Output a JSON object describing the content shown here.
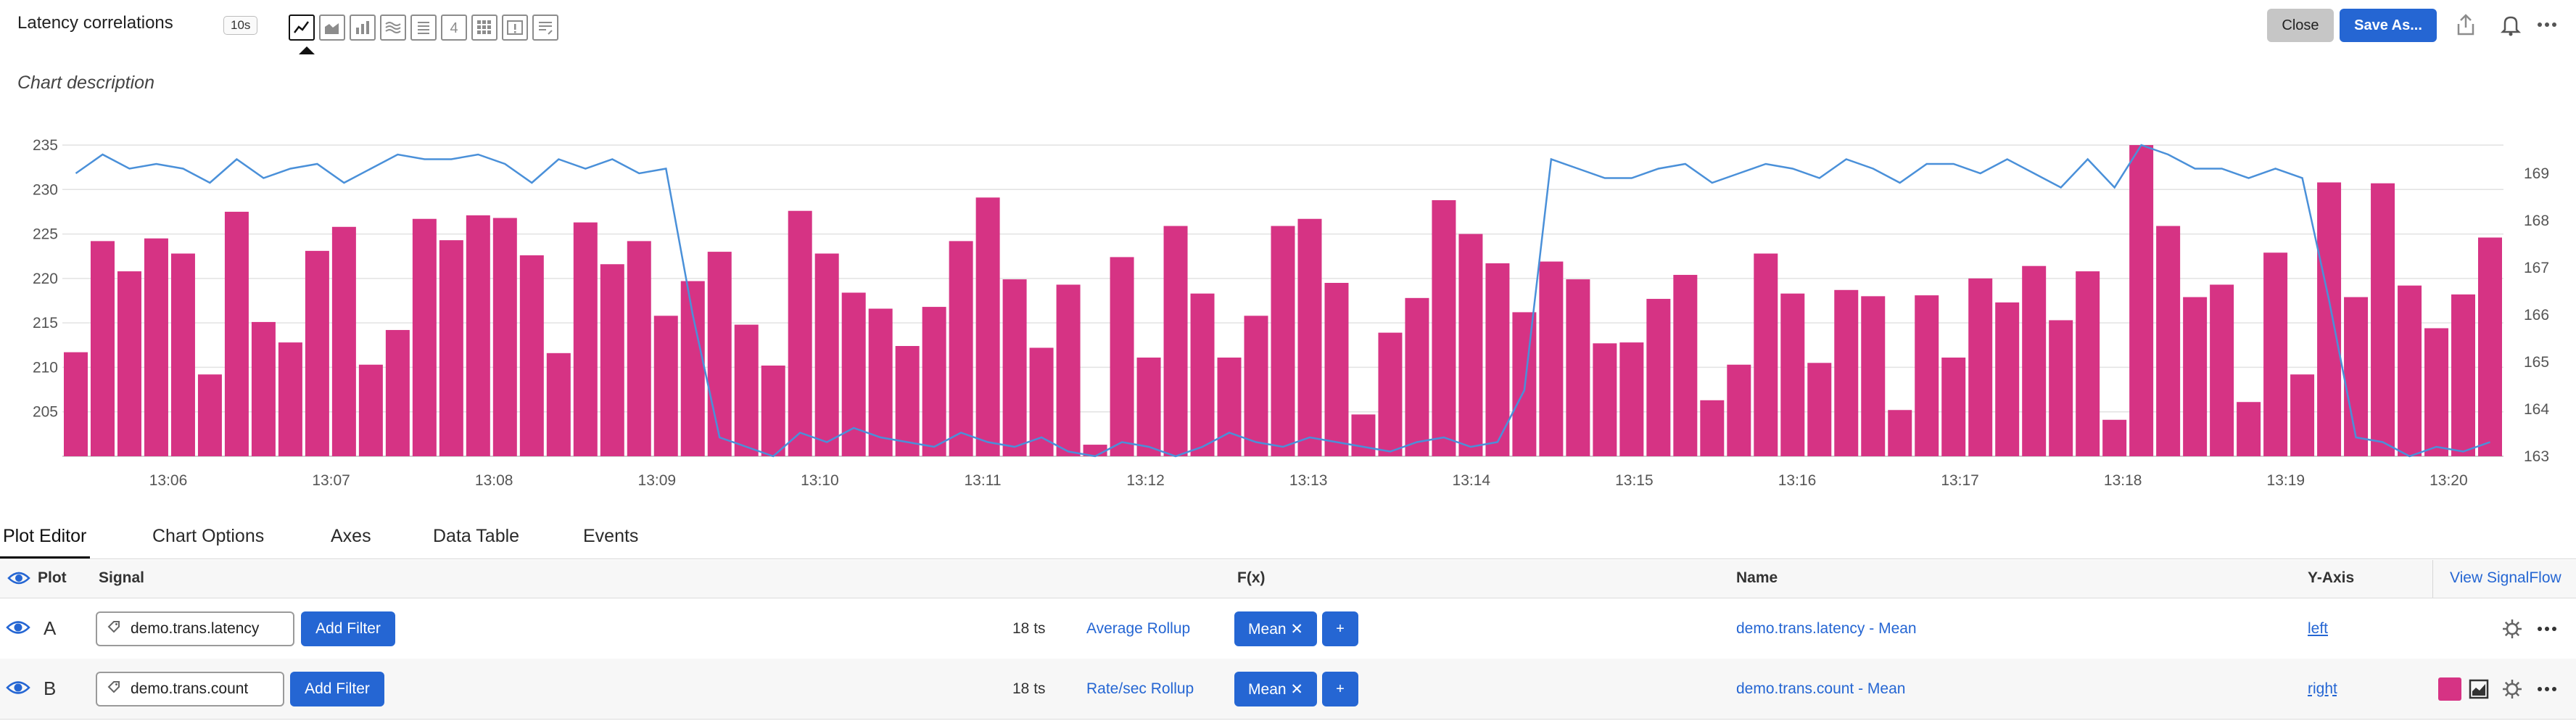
{
  "header": {
    "title": "Latency correlations",
    "resolution": "10s",
    "visualization_types": [
      "line-chart",
      "area-chart",
      "column-chart",
      "histogram",
      "list",
      "single-value",
      "heatmap",
      "event-feed",
      "text"
    ],
    "active_type": "line-chart",
    "close_label": "Close",
    "save_label": "Save As...",
    "accent_color": "#2566d3"
  },
  "description": "Chart description",
  "chart_data": {
    "type": "bar",
    "x_tick_labels": [
      "13:06",
      "13:07",
      "13:08",
      "13:09",
      "13:10",
      "13:11",
      "13:12",
      "13:13",
      "13:14",
      "13:15",
      "13:16",
      "13:17",
      "13:18",
      "13:19",
      "13:20"
    ],
    "y_left": {
      "ticks": [
        205,
        210,
        215,
        220,
        225,
        230,
        235
      ],
      "range": [
        200,
        235
      ]
    },
    "y_right": {
      "ticks": [
        163,
        164,
        165,
        166,
        167,
        168,
        169
      ],
      "range": [
        163,
        169.6
      ]
    },
    "grid": true,
    "series": [
      {
        "name": "demo.trans.latency - Mean",
        "axis": "left",
        "render": "column",
        "color": "#d63384",
        "values": [
          211.7,
          224.2,
          220.8,
          224.5,
          222.8,
          209.2,
          227.5,
          215.1,
          212.8,
          223.1,
          225.8,
          210.3,
          214.2,
          226.7,
          224.3,
          227.1,
          226.8,
          222.6,
          211.6,
          226.3,
          221.6,
          224.2,
          215.8,
          219.7,
          223.0,
          214.8,
          210.2,
          227.6,
          222.8,
          218.4,
          216.6,
          212.4,
          216.8,
          224.2,
          229.1,
          219.9,
          212.2,
          219.3,
          201.3,
          222.4,
          211.1,
          225.9,
          218.3,
          211.1,
          215.8,
          225.9,
          226.7,
          219.5,
          204.7,
          213.9,
          217.8,
          228.8,
          225.0,
          221.7,
          216.2,
          221.9,
          219.9,
          212.7,
          212.8,
          217.7,
          220.4,
          206.3,
          210.3,
          222.8,
          218.3,
          210.5,
          218.7,
          218.0,
          205.2,
          218.1,
          211.1,
          220.0,
          217.3,
          221.4,
          215.3,
          220.8,
          204.1,
          235.0,
          225.9,
          217.9,
          219.3,
          206.1,
          222.9,
          209.2,
          230.8,
          217.9,
          230.7,
          219.2,
          214.4,
          218.2,
          224.6
        ]
      },
      {
        "name": "demo.trans.count - Mean",
        "axis": "right",
        "render": "line",
        "color": "#4a90d9",
        "values": [
          169.0,
          169.4,
          169.1,
          169.2,
          169.1,
          168.8,
          169.3,
          168.9,
          169.1,
          169.2,
          168.8,
          169.1,
          169.4,
          169.3,
          169.3,
          169.4,
          169.2,
          168.8,
          169.3,
          169.1,
          169.3,
          169.0,
          169.1,
          166.0,
          163.4,
          163.2,
          163.0,
          163.5,
          163.3,
          163.6,
          163.4,
          163.3,
          163.2,
          163.5,
          163.3,
          163.2,
          163.4,
          163.1,
          163.0,
          163.3,
          163.2,
          163.0,
          163.2,
          163.5,
          163.3,
          163.2,
          163.4,
          163.3,
          163.2,
          163.1,
          163.3,
          163.4,
          163.2,
          163.3,
          164.4,
          169.3,
          169.1,
          168.9,
          168.9,
          169.1,
          169.2,
          168.8,
          169.0,
          169.2,
          169.1,
          168.9,
          169.3,
          169.1,
          168.8,
          169.2,
          169.2,
          169.0,
          169.3,
          169.0,
          168.7,
          169.3,
          168.7,
          169.6,
          169.4,
          169.1,
          169.1,
          168.9,
          169.1,
          168.9,
          166.3,
          163.4,
          163.3,
          163.0,
          163.2,
          163.1,
          163.3
        ]
      }
    ]
  },
  "tabs": [
    "Plot Editor",
    "Chart Options",
    "Axes",
    "Data Table",
    "Events"
  ],
  "active_tab": "Plot Editor",
  "table": {
    "headers": {
      "plot": "Plot",
      "signal": "Signal",
      "fx": "F(x)",
      "name": "Name",
      "y_axis": "Y-Axis",
      "view_signalflow": "View SignalFlow"
    },
    "rows": [
      {
        "letter": "A",
        "signal": "demo.trans.latency",
        "add_filter": "Add Filter",
        "ts_count": "18 ts",
        "rollup": "Average Rollup",
        "fx": "Mean ✕",
        "fx_add": "+",
        "name": "demo.trans.latency - Mean",
        "y_axis": "left",
        "icons": [
          "gear-icon",
          "more-icon"
        ]
      },
      {
        "letter": "B",
        "signal": "demo.trans.count",
        "add_filter": "Add Filter",
        "ts_count": "18 ts",
        "rollup": "Rate/sec Rollup",
        "fx": "Mean ✕",
        "fx_add": "+",
        "name": "demo.trans.count - Mean",
        "y_axis": "right",
        "color": "#d63384",
        "icons": [
          "color-swatch",
          "chart-type-icon",
          "gear-icon",
          "more-icon"
        ]
      }
    ]
  }
}
